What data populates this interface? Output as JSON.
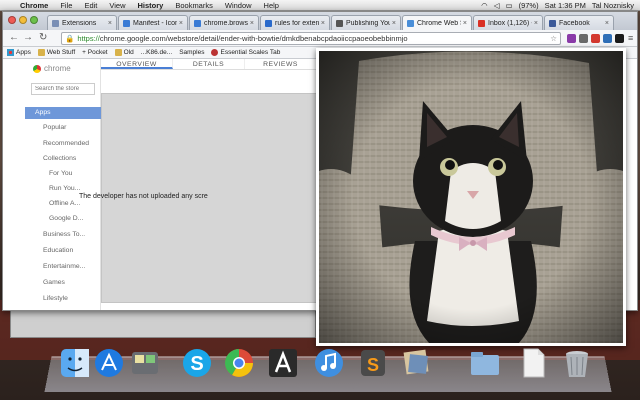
{
  "menubar": {
    "app": "Chrome",
    "items": [
      "File",
      "Edit",
      "View",
      "History",
      "Bookmarks",
      "Window",
      "Help"
    ],
    "battery": "(97%)",
    "clock": "Sat 1:36 PM",
    "user": "Tal Noznisky"
  },
  "tabs": [
    {
      "label": "Extensions",
      "color": "#7a8fb5"
    },
    {
      "label": "Manifest - Icons",
      "color": "#3a7bd5"
    },
    {
      "label": "chrome.browser",
      "color": "#3a7bd5"
    },
    {
      "label": "rules for extensi",
      "color": "#2a6acb"
    },
    {
      "label": "Publishing Your",
      "color": "#555555"
    },
    {
      "label": "Chrome Web Sto",
      "color": "#4a8ed8"
    },
    {
      "label": "Inbox (1,126) -",
      "color": "#d93025"
    },
    {
      "label": "Facebook",
      "color": "#3b5998"
    }
  ],
  "toolbar": {
    "url_scheme": "https://",
    "url_rest": "chrome.google.com/webstore/detail/ender-with-bowtie/dmkdbenabcpdaoiiccpaoeobebbinmjo"
  },
  "bookmarks": [
    {
      "label": "Apps"
    },
    {
      "label": "Web Stuff"
    },
    {
      "label": "+ Pocket"
    },
    {
      "label": "Old"
    },
    {
      "label": "...K86.de..."
    },
    {
      "label": "Samples"
    },
    {
      "label": "Essential Scales Tab"
    }
  ],
  "store": {
    "logo": "chrome",
    "search_placeholder": "Search the store",
    "sidebar": [
      {
        "label": "Apps",
        "active": true
      },
      {
        "label": "Popular"
      },
      {
        "label": "Recommended"
      },
      {
        "label": "Collections"
      },
      {
        "label": "For You"
      },
      {
        "label": "Run You..."
      },
      {
        "label": "Offline A..."
      },
      {
        "label": "Google D..."
      },
      {
        "label": "Business To..."
      },
      {
        "label": "Education"
      },
      {
        "label": "Entertainme..."
      },
      {
        "label": "Games"
      },
      {
        "label": "Lifestyle"
      }
    ],
    "detail_tabs": [
      "OVERVIEW",
      "DETAILS",
      "REVIEWS"
    ],
    "developer_message": "The developer has not uploaded any scre"
  },
  "colors": {
    "accent": "#6e97d9",
    "tab_underline": "#4a7fd5"
  }
}
